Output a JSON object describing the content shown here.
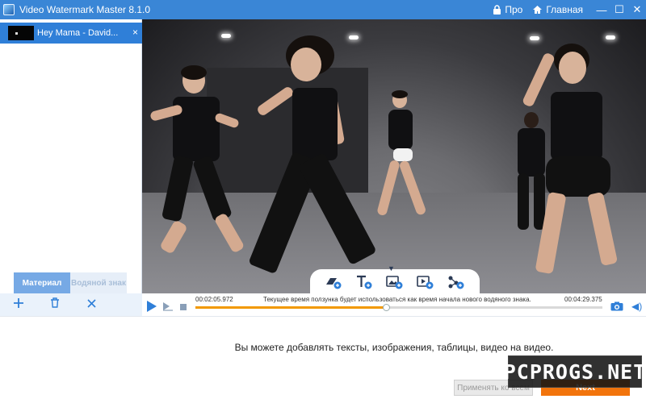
{
  "window": {
    "title": "Video Watermark Master 8.1.0",
    "pro_label": "Про",
    "home_label": "Главная",
    "icons": [
      "app-icon",
      "lock-icon",
      "home-icon",
      "minimize-icon",
      "maximize-icon",
      "close-icon"
    ]
  },
  "sidebar": {
    "file": {
      "name": "Hey Mama - David...",
      "close": "×"
    },
    "tabs": [
      {
        "label": "Материал",
        "active": true
      },
      {
        "label": "Водяной знак",
        "active": false
      }
    ],
    "tools": [
      {
        "name": "add",
        "glyph": "+"
      },
      {
        "name": "delete",
        "glyph": "🗑"
      },
      {
        "name": "clear",
        "glyph": "×"
      }
    ]
  },
  "video": {
    "watermark_tools": [
      "shape-watermark",
      "text-watermark",
      "image-watermark",
      "video-watermark",
      "table-watermark"
    ]
  },
  "playback": {
    "start_time": "00:02:05.972",
    "end_time": "00:04:29.375",
    "hint": "Текущее время ползунка будет использоваться как время начала нового водяного знака.",
    "progress_percent": 46.8
  },
  "footer": {
    "message": "Вы можете добавлять тексты, изображения, таблицы, видео на видео.",
    "apply_label": "Применять ко всем",
    "next_label": "Next",
    "overlay_watermark": "PCPROGS.NET"
  },
  "colors": {
    "accent": "#2f7fd8",
    "orange": "#f2740c",
    "titlebar": "#3a86d6"
  }
}
